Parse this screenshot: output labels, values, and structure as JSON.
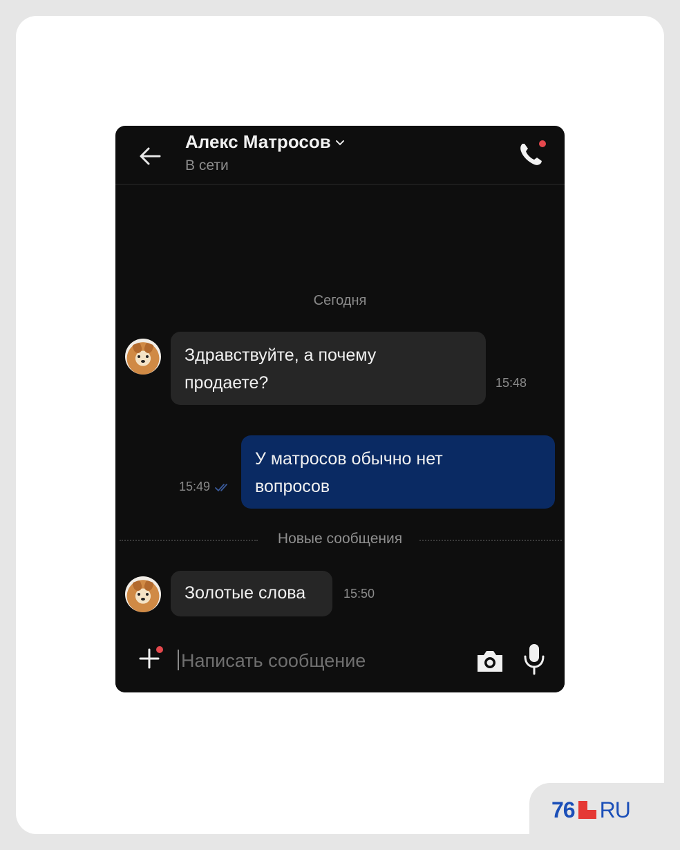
{
  "header": {
    "contact_name": "Алекс Матросов",
    "status": "В сети"
  },
  "chat": {
    "date_separator": "Сегодня",
    "messages": [
      {
        "direction": "incoming",
        "text_line1": "Здравствуйте, а почему",
        "text_line2": "продаете?",
        "time": "15:48"
      },
      {
        "direction": "outgoing",
        "text_line1": "У матросов обычно нет",
        "text_line2": "вопросов",
        "time": "15:49",
        "status": "read"
      },
      {
        "direction": "incoming",
        "text_line1": "Золотые слова",
        "time": "15:50"
      }
    ],
    "new_messages_label": "Новые сообщения"
  },
  "composer": {
    "placeholder": "Написать сообщение"
  },
  "branding": {
    "logo_num": "76",
    "logo_suffix": "RU"
  },
  "colors": {
    "outgoing_bubble": "#0a2a63",
    "incoming_bubble": "#262626",
    "notification_dot": "#e5484d",
    "logo_blue": "#1b4fb8",
    "logo_red": "#e53935"
  }
}
